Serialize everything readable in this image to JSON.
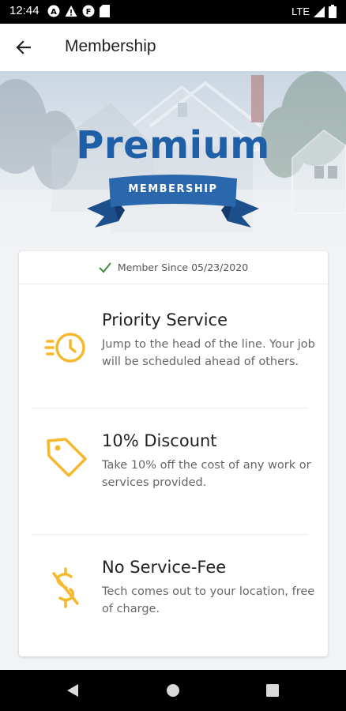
{
  "status_bar": {
    "time": "12:44",
    "network": "LTE",
    "left_icons": [
      "a-circle-icon",
      "warning-icon",
      "f-circle-icon",
      "sd-card-icon"
    ],
    "right_icons": [
      "signal-icon",
      "battery-icon"
    ]
  },
  "app_bar": {
    "title": "Membership",
    "back_icon": "arrow-left-icon"
  },
  "hero": {
    "title": "Premium",
    "ribbon_label": "MEMBERSHIP"
  },
  "card": {
    "member_since": "Member Since 05/23/2020",
    "member_since_icon": "check-icon",
    "benefits": [
      {
        "icon": "clock-fast-icon",
        "title": "Priority Service",
        "description": "Jump to the head of the line. Your job will be scheduled ahead of others."
      },
      {
        "icon": "tag-icon",
        "title": "10% Discount",
        "description": "Take 10% off the cost of any work or services provided."
      },
      {
        "icon": "no-dollar-icon",
        "title": "No Service-Fee",
        "description": "Tech comes out to your location, free of charge."
      }
    ]
  },
  "nav_bar": {
    "buttons": [
      "back-triangle-icon",
      "home-circle-icon",
      "recents-square-icon"
    ]
  },
  "colors": {
    "brand_blue": "#1f5fa8",
    "accent_yellow": "#f5b82e",
    "check_green": "#3a8f3a"
  }
}
